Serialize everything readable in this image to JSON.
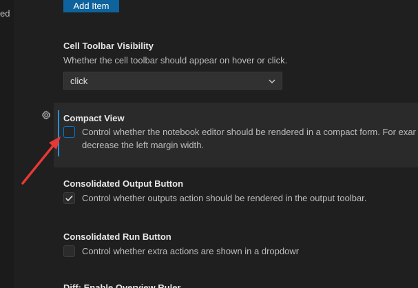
{
  "left_strip": {
    "text": "ed"
  },
  "add_item": {
    "label": "Add Item"
  },
  "cell_toolbar": {
    "title": "Cell Toolbar Visibility",
    "description": "Whether the cell toolbar should appear on hover or click.",
    "select_value": "click"
  },
  "compact_view": {
    "title": "Compact View",
    "description_line1": "Control whether the notebook editor should be rendered in a compact form. For exar",
    "description_line2": "decrease the left margin width.",
    "checked": false
  },
  "consolidated_output": {
    "title": "Consolidated Output Button",
    "description": "Control whether outputs action should be rendered in the output toolbar.",
    "checked": true
  },
  "consolidated_run": {
    "title": "Consolidated Run Button",
    "description": "Control whether extra actions are shown in a dropdowr",
    "checked": false
  },
  "next_setting": {
    "title": "Diff: Enable Overview Ruler"
  },
  "icons": {
    "gear": "gear-icon",
    "chevron": "chevron-down-icon",
    "check": "check-icon"
  },
  "colors": {
    "accent": "#0e639c",
    "focus": "#2b8fd6",
    "annotation_arrow": "#e53935"
  }
}
